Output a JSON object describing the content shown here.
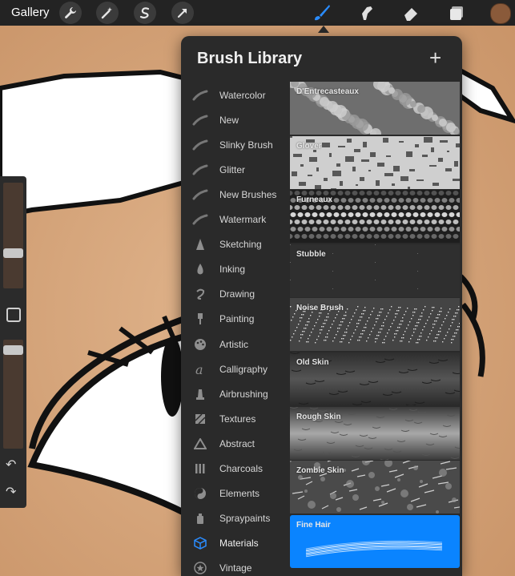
{
  "toolbar": {
    "gallery_label": "Gallery",
    "actions": [
      "wrench-icon",
      "magic-wand-icon",
      "selection-s-icon",
      "transform-arrow-icon"
    ],
    "tools": [
      "brush-icon",
      "smudge-icon",
      "eraser-icon",
      "layers-icon"
    ],
    "active_tool": "brush-icon",
    "current_color": "#8a5a3a"
  },
  "sidebar": {
    "size_slider_fraction": 0.42,
    "opacity_slider_fraction": 0.06,
    "undo_icon": "↶",
    "redo_icon": "↷"
  },
  "library": {
    "title": "Brush Library",
    "add_label": "+",
    "categories": [
      {
        "label": "Watercolor",
        "icon": "stroke"
      },
      {
        "label": "New",
        "icon": "stroke"
      },
      {
        "label": "Slinky Brush",
        "icon": "stroke"
      },
      {
        "label": "Glitter",
        "icon": "stroke"
      },
      {
        "label": "New Brushes",
        "icon": "stroke"
      },
      {
        "label": "Watermark",
        "icon": "stroke"
      },
      {
        "label": "Sketching",
        "icon": "pencil-tip"
      },
      {
        "label": "Inking",
        "icon": "ink-drop"
      },
      {
        "label": "Drawing",
        "icon": "swirl"
      },
      {
        "label": "Painting",
        "icon": "paint-brush"
      },
      {
        "label": "Artistic",
        "icon": "palette"
      },
      {
        "label": "Calligraphy",
        "icon": "letter-a"
      },
      {
        "label": "Airbrushing",
        "icon": "airbrush"
      },
      {
        "label": "Textures",
        "icon": "hatch-square"
      },
      {
        "label": "Abstract",
        "icon": "triangle"
      },
      {
        "label": "Charcoals",
        "icon": "bars"
      },
      {
        "label": "Elements",
        "icon": "yin-yang"
      },
      {
        "label": "Spraypaints",
        "icon": "spray-can"
      },
      {
        "label": "Materials",
        "icon": "cube"
      },
      {
        "label": "Vintage",
        "icon": "star-circle"
      }
    ],
    "active_category": "Materials",
    "brushes": [
      {
        "name": "D'Entrecasteaux",
        "style": "mottled"
      },
      {
        "name": "Glover",
        "style": "grunge"
      },
      {
        "name": "Furneaux",
        "style": "cells"
      },
      {
        "name": "Stubble",
        "style": "dark-grain"
      },
      {
        "name": "Noise Brush",
        "style": "noise"
      },
      {
        "name": "Old Skin",
        "style": "leather-dark"
      },
      {
        "name": "Rough Skin",
        "style": "leather-light"
      },
      {
        "name": "Zombie Skin",
        "style": "cracked"
      },
      {
        "name": "Fine Hair",
        "style": "hair"
      }
    ],
    "selected_brush": "Fine Hair"
  }
}
